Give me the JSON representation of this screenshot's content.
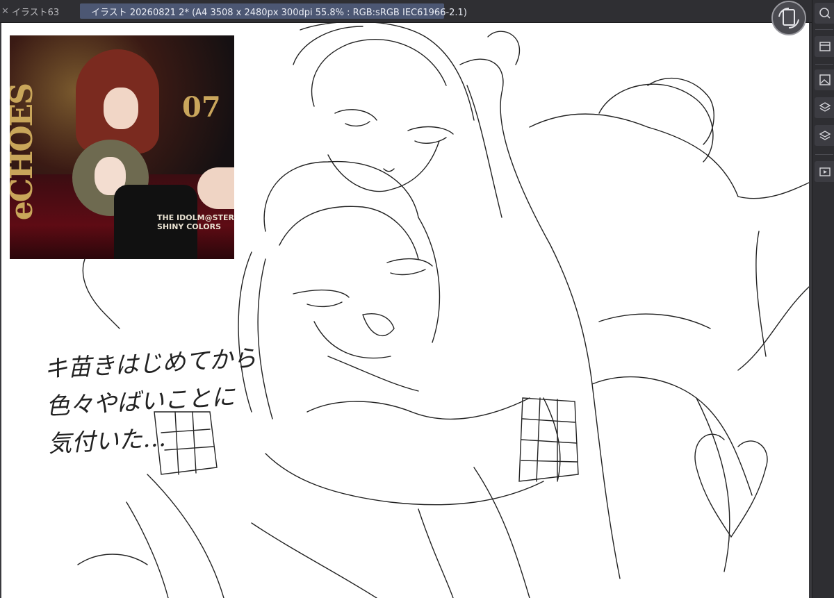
{
  "tabs": [
    {
      "label": "イラスト63",
      "active": false
    },
    {
      "label": "イラスト 20260821 2* (A4 3508 x 2480px 300dpi 55.8% : RGB:sRGB IEC61966-2.1)",
      "active": true
    }
  ],
  "reference_image": {
    "title": "eCHOES",
    "number": "07",
    "brand_line1": "THE IDOLM@STER",
    "brand_line2": "SHINY COLORS"
  },
  "handwritten_note": {
    "line1": "キ苗きはじめてから",
    "line2": "色々やばいことに",
    "line3": "気付いた…"
  },
  "icons": {
    "rotate": "rotate-canvas-icon",
    "panel": [
      "window-icon",
      "cube-icon",
      "image-icon",
      "layers-stack-icon",
      "layers-icon",
      "animation-icon"
    ]
  },
  "colors": {
    "active_tab": "#4c5773",
    "chrome": "#2f2f33",
    "canvas": "#ffffff"
  }
}
